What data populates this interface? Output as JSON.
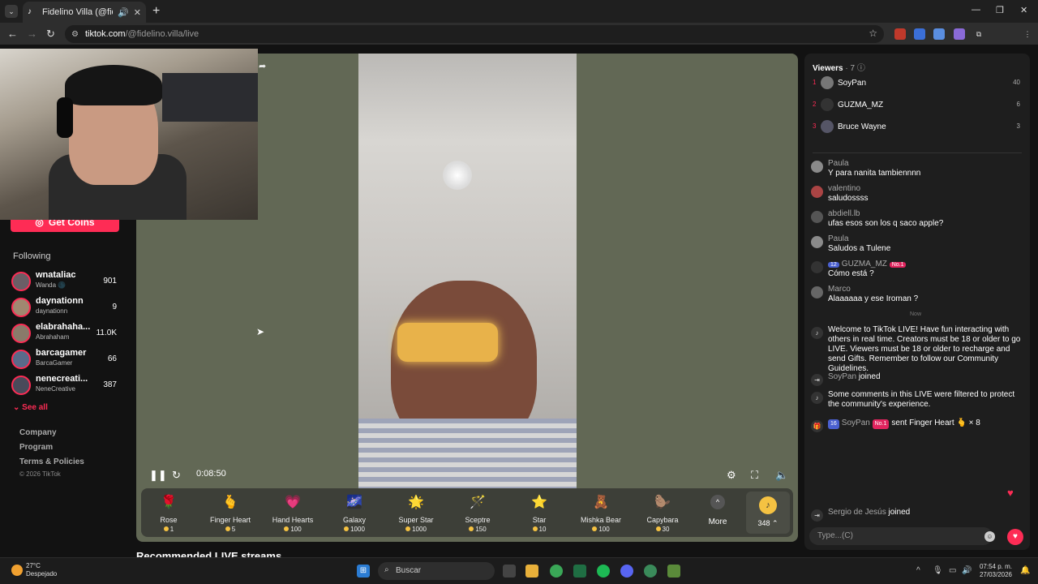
{
  "browser": {
    "tab_title": "Fidelino Villa (@fidelino.vill",
    "url_host": "tiktok.com",
    "url_path": "/@fidelino.villa/live"
  },
  "sidebar": {
    "get_coins": "Get Coins",
    "following_label": "Following",
    "following": [
      {
        "name": "wnataliac",
        "sub": "Wanda 🌑",
        "count": "901"
      },
      {
        "name": "daynationn",
        "sub": "daynationn",
        "count": "9"
      },
      {
        "name": "elabrahaha...",
        "sub": "Abrahaham",
        "count": "11.0K"
      },
      {
        "name": "barcagamer",
        "sub": "BarcaGamer",
        "count": "66"
      },
      {
        "name": "nenecreati...",
        "sub": "NeneCreative",
        "count": "387"
      }
    ],
    "see_all": "See all",
    "footer_links": [
      "Company",
      "Program",
      "Terms & Policies"
    ],
    "copyright": "© 2026 TikTok"
  },
  "player": {
    "time": "0:08:50"
  },
  "gifts": [
    {
      "name": "Rose",
      "price": "1",
      "emoji": "🌹"
    },
    {
      "name": "Finger Heart",
      "price": "5",
      "emoji": "🫰"
    },
    {
      "name": "Hand Hearts",
      "price": "100",
      "emoji": "💗"
    },
    {
      "name": "Galaxy",
      "price": "1000",
      "emoji": "🌌"
    },
    {
      "name": "Super Star",
      "price": "1000",
      "emoji": "🌟"
    },
    {
      "name": "Sceptre",
      "price": "150",
      "emoji": "🪄"
    },
    {
      "name": "Star",
      "price": "10",
      "emoji": "⭐"
    },
    {
      "name": "Mishka Bear",
      "price": "100",
      "emoji": "🧸"
    },
    {
      "name": "Capybara",
      "price": "30",
      "emoji": "🦫"
    }
  ],
  "more_label": "More",
  "coins": "348",
  "recommended": "Recommended LIVE streams",
  "chat": {
    "viewers_title": "Viewers",
    "viewers_count": "· 7",
    "viewers": [
      {
        "rank": "1",
        "name": "SoyPan",
        "score": "40"
      },
      {
        "rank": "2",
        "name": "GUZMA_MZ",
        "score": "6"
      },
      {
        "rank": "3",
        "name": "Bruce Wayne",
        "score": "3"
      }
    ],
    "messages": [
      {
        "user": "Paula",
        "text": "Y para nanita tambiennnn"
      },
      {
        "user": "valentino",
        "text": "saludossss"
      },
      {
        "user": "abdiell.lb",
        "text": "ufas esos son los q saco apple?"
      },
      {
        "user": "Paula",
        "text": "Saludos a Tulene"
      },
      {
        "user": "GUZMA_MZ",
        "text": "Cómo está ?",
        "level": "12",
        "rank_badge": "No.1"
      },
      {
        "user": "Marco",
        "text": "Alaaaaaa y ese Iroman ?"
      }
    ],
    "now_label": "Now",
    "welcome": "Welcome to TikTok LIVE! Have fun interacting with others in real time. Creators must be 18 or older to go LIVE. Viewers must be 18 or older to recharge and send Gifts. Remember to follow our Community Guidelines.",
    "join1_user": "SoyPan",
    "join1_text": "joined",
    "filtered": "Some comments in this LIVE were filtered to protect the community's experience.",
    "gift_user": "SoyPan",
    "gift_level": "16",
    "gift_rank": "No.1",
    "gift_text": "sent Finger Heart 🫰 × 8",
    "join2_user": "Sergio de Jesús",
    "join2_text": "joined",
    "input_placeholder": "Type...(C)"
  },
  "taskbar": {
    "temp": "27°C",
    "weather": "Despejado",
    "search": "Buscar",
    "time": "07:54 p. m.",
    "date": "27/03/2026"
  }
}
